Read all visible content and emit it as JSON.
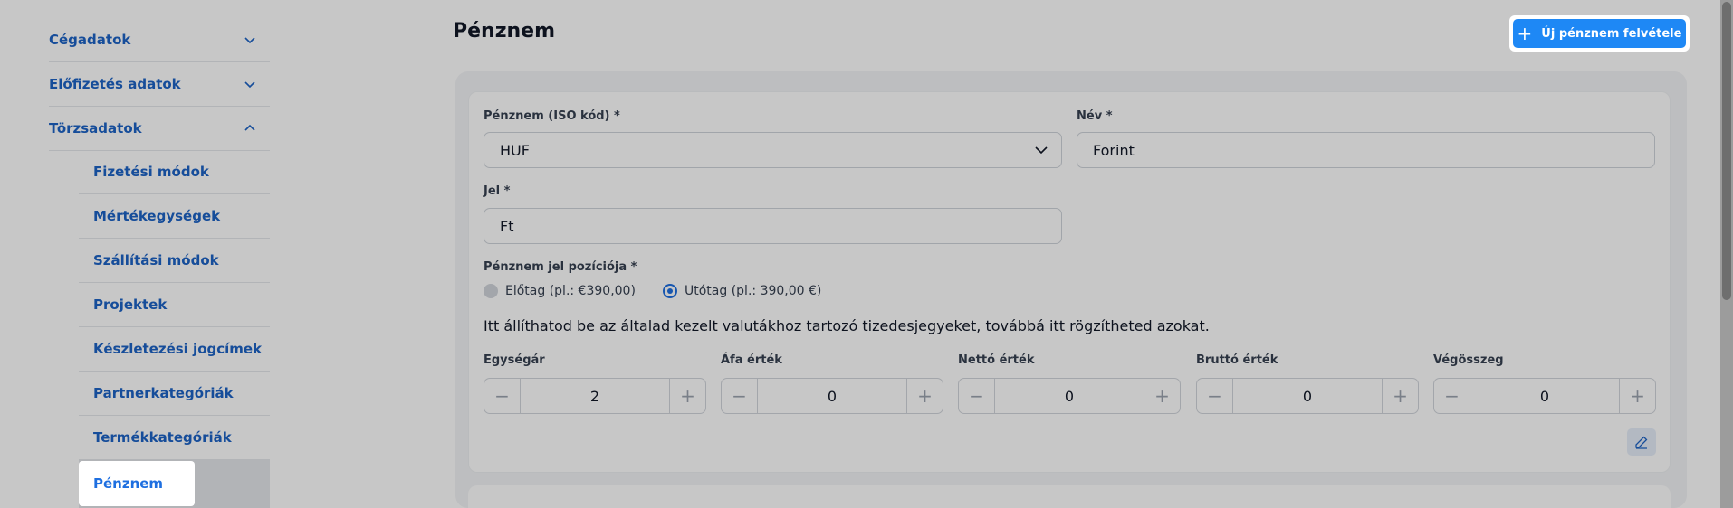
{
  "sidebar": {
    "sections": [
      {
        "label": "Cégadatok",
        "expanded": false
      },
      {
        "label": "Előfizetés adatok",
        "expanded": false
      },
      {
        "label": "Törzsadatok",
        "expanded": true
      }
    ],
    "items": [
      {
        "label": "Fizetési módok"
      },
      {
        "label": "Mértékegységek"
      },
      {
        "label": "Szállítási módok"
      },
      {
        "label": "Projektek"
      },
      {
        "label": "Készletezési jogcímek"
      },
      {
        "label": "Partnerkategóriák"
      },
      {
        "label": "Termékkategóriák"
      },
      {
        "label": "Pénznem",
        "active": true
      }
    ]
  },
  "header": {
    "title": "Pénznem",
    "add_button_label": "Új pénznem felvétele",
    "add_button_icon": "plus-icon"
  },
  "form": {
    "currency_label": "Pénznem (ISO kód) *",
    "currency_value": "HUF",
    "name_label": "Név *",
    "name_value": "Forint",
    "symbol_label": "Jel *",
    "symbol_value": "Ft",
    "position_label": "Pénznem jel pozíciója *",
    "prefix_label": "Előtag (pl.: €390,00)",
    "suffix_label": "Utótag (pl.: 390,00 €)",
    "selected_position": "suffix",
    "info_text": "Itt állíthatod be az általad kezelt valutákhoz tartozó tizedesjegyeket, továbbá itt rögzítheted azokat.",
    "decimals": [
      {
        "label": "Egységár",
        "value": "2"
      },
      {
        "label": "Áfa érték",
        "value": "0"
      },
      {
        "label": "Nettó érték",
        "value": "0"
      },
      {
        "label": "Bruttó érték",
        "value": "0"
      },
      {
        "label": "Végösszeg",
        "value": "0"
      }
    ],
    "stepper_minus": "−",
    "stepper_plus": "+"
  },
  "colors": {
    "accent": "#1e88f5",
    "link": "#1d63c6"
  }
}
